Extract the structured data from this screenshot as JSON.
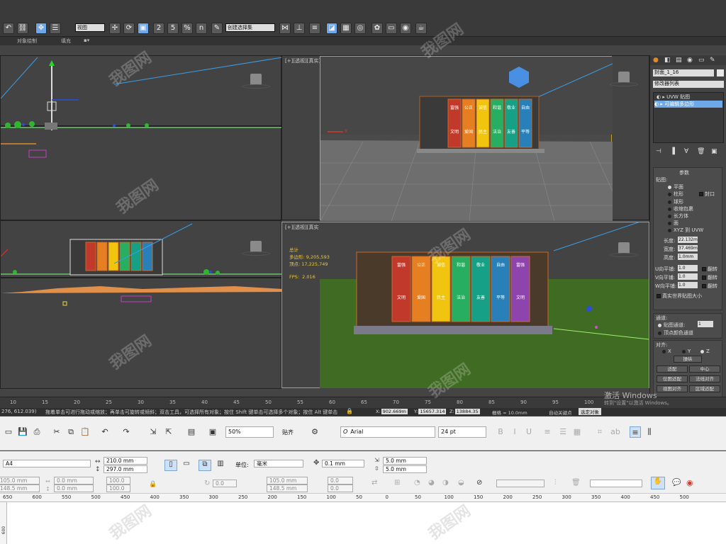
{
  "max_toolbar": {
    "view_dropdown": "视图",
    "selection_set": "创建选择集",
    "snap_labels": [
      "2",
      "5",
      "%",
      "n"
    ]
  },
  "ribbon": {
    "items": [
      "对象绘制",
      "填充"
    ]
  },
  "viewports": {
    "top_right_label": "[+][透视][真实]",
    "bottom_right_label": "[+][透视][真实 + 边面]",
    "stats": {
      "total_label": "总计",
      "polys_label": "多边形:",
      "polys_value": "9,205,593",
      "verts_label": "顶点:",
      "verts_value": "17,225,749",
      "fps_label": "FPS:",
      "fps_value": "2.016"
    },
    "panel_words": [
      "社会",
      "主义"
    ],
    "board_chars": [
      "富强",
      "文明",
      "公正",
      "爱国",
      "诚信",
      "民主",
      "和谐",
      "法治",
      "敬业",
      "友善",
      "自由",
      "平等"
    ],
    "gizmo_x": "X",
    "gizmo_y": "Y"
  },
  "right_panel": {
    "object_name": "封面_1_16",
    "modifier_list": "修改器列表",
    "stack": [
      "UVW 贴图",
      "可编辑多边形"
    ],
    "params_title": "参数",
    "mapping_label": "贴图:",
    "mapping_options": [
      "平面",
      "柱形",
      "球形",
      "收缩包裹",
      "长方体",
      "面",
      "XYZ 到 UVW"
    ],
    "cap_label": "封口",
    "length_label": "长度:",
    "length_value": "22.132m",
    "width_label": "宽度:",
    "width_value": "37.469m",
    "height_label": "高度:",
    "height_value": "1.0mm",
    "utile_label": "U向平铺:",
    "vtile_label": "V向平铺:",
    "wtile_label": "W向平铺:",
    "tile_value": "1.0",
    "flip_label": "翻转",
    "realworld_label": "真实世界贴图大小",
    "channel_label": "通道:",
    "map_channel_label": "贴图通道:",
    "map_channel_value": "1",
    "vertex_color_label": "顶点颜色通道",
    "align_label": "对齐:",
    "axes": [
      "X",
      "Y",
      "Z"
    ],
    "buttons": [
      "操纵",
      "适配",
      "中心",
      "位图适配",
      "法线对齐",
      "视图对齐",
      "区域适配",
      "重置"
    ]
  },
  "timeline": {
    "ticks": [
      "10",
      "15",
      "20",
      "25",
      "30",
      "35",
      "40",
      "45",
      "50",
      "55",
      "60",
      "65",
      "70",
      "75",
      "80",
      "85",
      "90",
      "95",
      "100"
    ]
  },
  "status": {
    "left_text": "276, 612.039)",
    "hint_text": "拖着单击可进行拖动或缩放；再单击可旋转或倾斜；双击工具，可选择所有对象；按住 Shift 键单击可选择多个对象；按住 Alt 键单击",
    "x_label": "X:",
    "x_value": "902.669m",
    "y_label": "Y:",
    "y_value": "15657.314",
    "z_label": "Z:",
    "z_value": "13884.35",
    "grid_text": "栅格 = 10.0mm",
    "autokey": "自动关键点",
    "select_obj": "选定对象",
    "activate_line1": "激活 Windows",
    "activate_line2": "转到\"设置\"以激活 Windows。"
  },
  "corel": {
    "zoom": "50%",
    "snap": "贴齐",
    "font_name": "Arial",
    "font_size": "24 pt",
    "page_size": "A4",
    "width": "210.0 mm",
    "height": "297.0 mm",
    "unit_label": "单位:",
    "unit_value": "毫米",
    "nudge": "0.1 mm",
    "dup_x": "5.0 mm",
    "dup_y": "5.0 mm",
    "pos_x": "105.0 mm",
    "pos_y": "148.5 mm",
    "off_x": "0.0 mm",
    "off_y": "0.0 mm",
    "scale_x": "100.0",
    "scale_y": "100.0",
    "rot": "0.0",
    "pos2_x": "105.0 mm",
    "pos2_y": "148.5 mm",
    "skew_x": "0.0",
    "skew_y": "0.0",
    "ruler_ticks": [
      "650",
      "600",
      "550",
      "500",
      "450",
      "400",
      "350",
      "300",
      "250",
      "200",
      "150",
      "100",
      "50",
      "0",
      "50",
      "100",
      "150",
      "200",
      "250",
      "300",
      "350",
      "400",
      "450",
      "500"
    ],
    "vruler_label": "600"
  },
  "colors": {
    "active_border": "#c8a12a",
    "selected_blue": "#6fa8e8",
    "grass": "#3f6b22"
  }
}
